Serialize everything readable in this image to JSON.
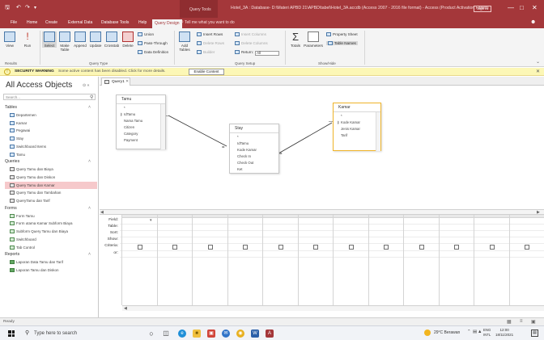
{
  "titlebar": {
    "context_tab": "Query Tools",
    "title": "Hotel_3A : Database- D:\\Materi APBD 21\\APBD\\tabel\\Hotel_3A.accdb (Access 2007 - 2016 file format) - Access (Product Activation Failed)",
    "signin": "Sign in",
    "icons": [
      "save-icon",
      "undo-icon",
      "redo-icon"
    ]
  },
  "tabs": {
    "file": "File",
    "home": "Home",
    "create": "Create",
    "external": "External Data",
    "dbtools": "Database Tools",
    "help": "Help",
    "query_design": "Query Design",
    "tell_me": "Tell me what you want to do"
  },
  "ribbon": {
    "view": "View",
    "run": "Run",
    "select": "Select",
    "make_table_1": "Make",
    "make_table_2": "Table",
    "append": "Append",
    "update": "Update",
    "crosstab": "Crosstab",
    "delete": "Delete",
    "union": "Union",
    "pass_through": "Pass-Through",
    "data_definition": "Data Definition",
    "add_tables_1": "Add",
    "add_tables_2": "Tables",
    "builder": "Builder",
    "insert_rows": "Insert Rows",
    "delete_rows": "Delete Rows",
    "insert_columns": "Insert Columns",
    "delete_columns": "Delete Columns",
    "return": "Return:",
    "return_value": "All",
    "totals": "Totals",
    "parameters": "Parameters",
    "property_sheet": "Property Sheet",
    "table_names": "Table Names",
    "groups": {
      "results": "Results",
      "query_type": "Query Type",
      "query_setup": "Query Setup",
      "show_hide": "Show/Hide"
    }
  },
  "security": {
    "title": "SECURITY WARNING",
    "message": "Some active content has been disabled. Click for more details.",
    "enable": "Enable Content"
  },
  "nav": {
    "title": "All Access Objects",
    "search_placeholder": "Search...",
    "sections": [
      {
        "name": "Tables",
        "items": [
          "Departemen",
          "Kamar",
          "Pegawai",
          "Stay",
          "Switchboard Items",
          "Tamu"
        ]
      },
      {
        "name": "Queries",
        "items": [
          "Query Tamu dan Biaya",
          "Query Tamu dan Diskon",
          "Query Tamu dan Kamar",
          "Query Tamu dan Tambahan",
          "QueryTamu dan Tarif"
        ]
      },
      {
        "name": "Forms",
        "items": [
          "Form Tamu",
          "Form utama Kamar Subform Biaya",
          "Subform Query Tamu dan Biaya",
          "Switchboard",
          "Tab Control"
        ]
      },
      {
        "name": "Reports",
        "items": [
          "Laporan Data Tamu dan Tarif",
          "Laporan Tamu dan Diskon"
        ]
      }
    ],
    "selected": "Query Tamu dan Kamar"
  },
  "query_tab": {
    "label": "Query1"
  },
  "tables": {
    "tamu": {
      "name": "Tamu",
      "fields": [
        "*",
        "IdTamu",
        "Nama Tamu",
        "Citizen",
        "Category",
        "Payment"
      ],
      "key": "IdTamu"
    },
    "stay": {
      "name": "Stay",
      "fields": [
        "*",
        "IdTamu",
        "Kode Kamar",
        "Check In",
        "Check Out",
        "Ket"
      ],
      "key": ""
    },
    "kamar": {
      "name": "Kamar",
      "fields": [
        "*",
        "Kode Kamar",
        "Jenis Kamar",
        "Tarif"
      ],
      "key": "Kode Kamar"
    }
  },
  "grid": {
    "labels": [
      "Field:",
      "Table:",
      "Sort:",
      "Show:",
      "Criteria:",
      "or:"
    ]
  },
  "status": {
    "text": "Ready"
  },
  "taskbar": {
    "search": "Type here to search",
    "weather": "29°C Berawan",
    "lang_1": "ENG",
    "lang_2": "INTL",
    "time": "12:00",
    "date": "18/11/2021"
  }
}
